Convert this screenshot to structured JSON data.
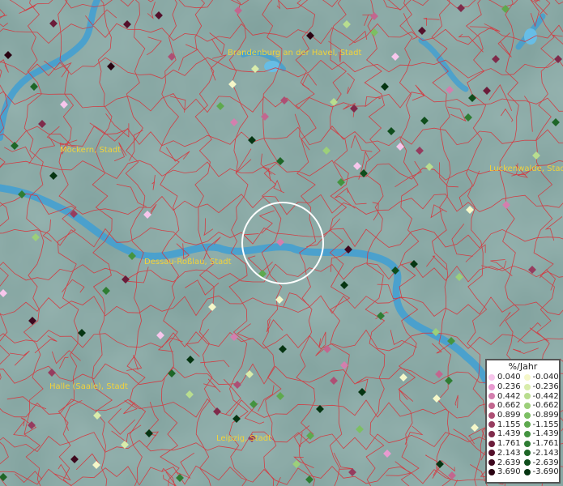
{
  "cities": [
    {
      "name": "Brandenburg an der Havel, Stadt"
    },
    {
      "name": "Möckern, Stadt"
    },
    {
      "name": "Luckenwalde, Stadt"
    },
    {
      "name": "Dessau-Roßlau, Stadt"
    },
    {
      "name": "Halle (Saale), Stadt"
    },
    {
      "name": "Leipzig, Stadt"
    }
  ],
  "legend": {
    "title": "%/Jahr",
    "positive": [
      "0.040",
      "0.236",
      "0.442",
      "0.662",
      "0.899",
      "1.155",
      "1.439",
      "1.761",
      "2.143",
      "2.639",
      "3.690"
    ],
    "negative": [
      "-0.040",
      "-0.236",
      "-0.442",
      "-0.662",
      "-0.899",
      "-1.155",
      "-1.439",
      "-1.761",
      "-2.143",
      "-2.639",
      "-3.690"
    ],
    "positive_colors": [
      "#f7c6ec",
      "#e89ad0",
      "#d37fae",
      "#c2678f",
      "#ad4f74",
      "#963c5f",
      "#7f2b4b",
      "#6b1c3a",
      "#54102b",
      "#3e081e",
      "#2a0312"
    ],
    "negative_colors": [
      "#f5f7c9",
      "#d8ecab",
      "#b8dd8f",
      "#9ccf7a",
      "#7cbf63",
      "#5ea94e",
      "#449440",
      "#2f7d33",
      "#1e6627",
      "#0f4e1c",
      "#063512"
    ]
  },
  "colors": {
    "land": "#7fa09c",
    "river": "#3f9fd3",
    "borders": "#d8333a",
    "label": "#f2d23a"
  }
}
